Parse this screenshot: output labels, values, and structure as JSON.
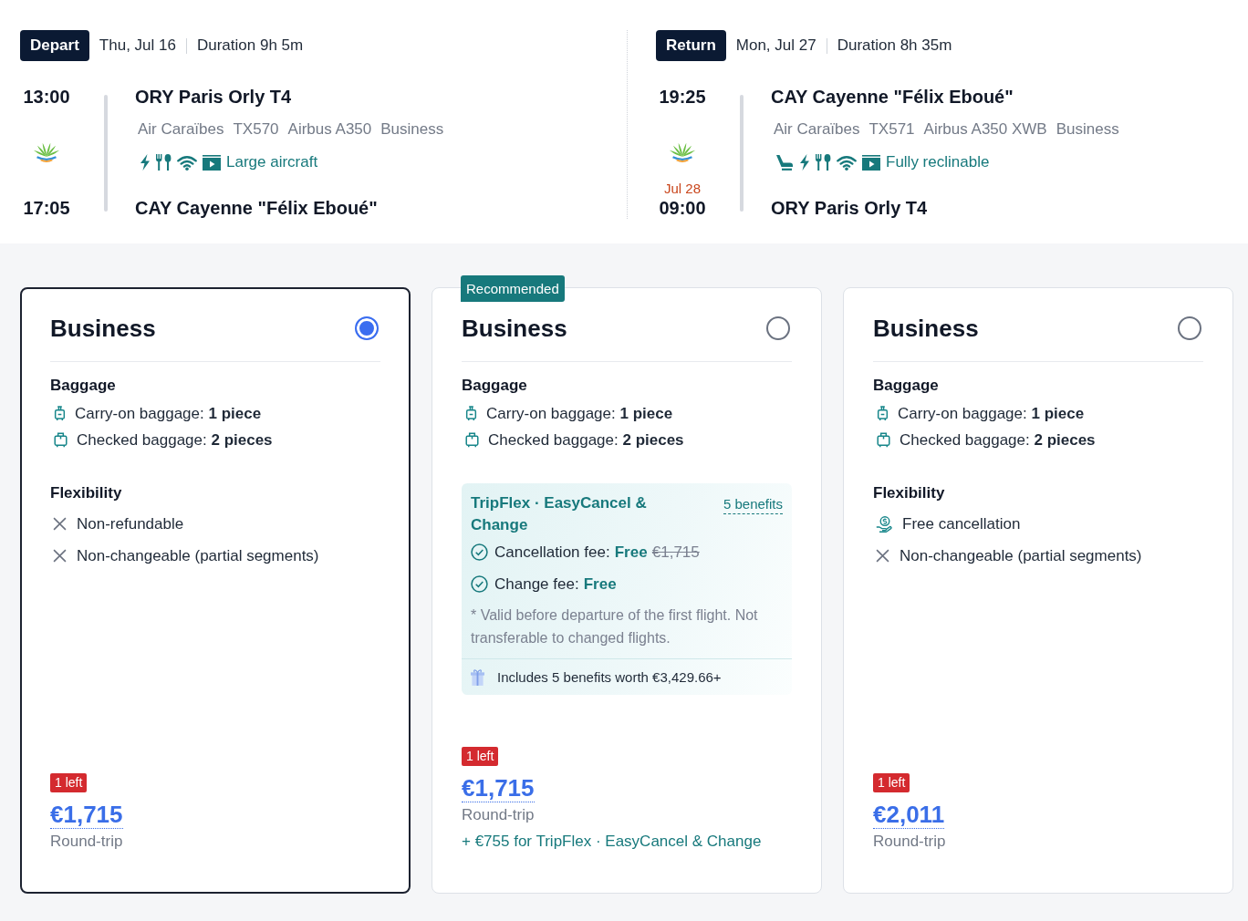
{
  "flights": [
    {
      "label": "Depart",
      "date": "Thu, Jul 16",
      "duration": "Duration 9h 5m",
      "departure": {
        "time": "13:00",
        "airport": "ORY Paris Orly T4"
      },
      "arrival": {
        "time": "17:05",
        "airport": "CAY Cayenne \"Félix Eboué\""
      },
      "details": {
        "airline": "Air Caraïbes",
        "flight_number": "TX570",
        "aircraft": "Airbus A350",
        "cabin": "Business"
      },
      "amenities": [
        {
          "kind": "power"
        },
        {
          "kind": "meal"
        },
        {
          "kind": "wifi"
        },
        {
          "kind": "entertainment"
        }
      ],
      "feature": "Large aircraft"
    },
    {
      "label": "Return",
      "date": "Mon, Jul 27",
      "duration": "Duration 8h 35m",
      "departure": {
        "time": "19:25",
        "airport": "CAY Cayenne \"Félix Eboué\""
      },
      "arrival": {
        "date": "Jul 28",
        "time": "09:00",
        "airport": "ORY Paris Orly T4"
      },
      "details": {
        "airline": "Air Caraïbes",
        "flight_number": "TX571",
        "aircraft": "Airbus A350 XWB",
        "cabin": "Business"
      },
      "amenities": [
        {
          "kind": "seat"
        },
        {
          "kind": "power"
        },
        {
          "kind": "meal"
        },
        {
          "kind": "wifi"
        },
        {
          "kind": "entertainment"
        }
      ],
      "feature": "Fully reclinable"
    }
  ],
  "fares": [
    {
      "name": "Business",
      "selected": true,
      "baggage": {
        "title": "Baggage",
        "items": [
          {
            "kind": "carry-on",
            "text": "Carry-on baggage: **1 piece**"
          },
          {
            "kind": "checked",
            "text": "Checked baggage: **2 pieces**"
          }
        ]
      },
      "flexibility": {
        "title": "Flexibility",
        "items": [
          {
            "kind": "not-included",
            "text": "Non-refundable"
          },
          {
            "kind": "not-included",
            "text": "Non-changeable (partial segments)"
          }
        ]
      },
      "stock": "1 left",
      "price": "€1,715",
      "price_note": "Round-trip"
    },
    {
      "name": "Business",
      "selected": false,
      "badge": "Recommended",
      "baggage": {
        "title": "Baggage",
        "items": [
          {
            "kind": "carry-on",
            "text": "Carry-on baggage: **1 piece**"
          },
          {
            "kind": "checked",
            "text": "Checked baggage: **2 pieces**"
          }
        ]
      },
      "tripflex": {
        "title": "TripFlex · EasyCancel & Change",
        "link": "5 benefits",
        "fees": [
          {
            "label": "Cancellation fee:",
            "value": "Free",
            "old_price": "€1,715"
          },
          {
            "label": "Change fee:",
            "value": "Free"
          }
        ],
        "note": "* Valid before departure of the first flight. Not transferable to changed flights.",
        "benefits": "Includes 5 benefits worth €3,429.66+"
      },
      "stock": "1 left",
      "price": "€1,715",
      "price_note": "Round-trip",
      "addon": "+ €755 for TripFlex · EasyCancel & Change"
    },
    {
      "name": "Business",
      "selected": false,
      "baggage": {
        "title": "Baggage",
        "items": [
          {
            "kind": "carry-on",
            "text": "Carry-on baggage: **1 piece**"
          },
          {
            "kind": "checked",
            "text": "Checked baggage: **2 pieces**"
          }
        ]
      },
      "flexibility": {
        "title": "Flexibility",
        "items": [
          {
            "kind": "free-cancel",
            "text": "Free cancellation"
          },
          {
            "kind": "not-included",
            "text": "Non-changeable (partial segments)"
          }
        ]
      },
      "stock": "1 left",
      "price": "€2,011",
      "price_note": "Round-trip"
    }
  ]
}
